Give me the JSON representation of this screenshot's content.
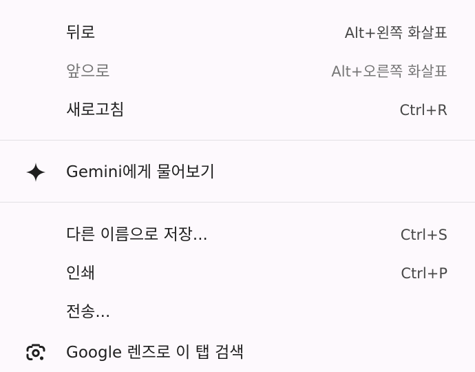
{
  "menu": {
    "items": [
      {
        "label": "뒤로",
        "shortcut": "Alt+왼쪽 화살표"
      },
      {
        "label": "앞으로",
        "shortcut": "Alt+오른쪽 화살표"
      },
      {
        "label": "새로고침",
        "shortcut": "Ctrl+R"
      },
      {
        "label": "Gemini에게 물어보기",
        "icon": "gemini-sparkle-icon"
      },
      {
        "label": "다른 이름으로 저장...",
        "shortcut": "Ctrl+S"
      },
      {
        "label": "인쇄",
        "shortcut": "Ctrl+P"
      },
      {
        "label": "전송..."
      },
      {
        "label": "Google 렌즈로 이 탭 검색",
        "icon": "google-lens-icon"
      }
    ]
  },
  "colors": {
    "background": "#fdf9fd",
    "text": "#1f1f1f",
    "disabled_text": "#767676",
    "separator": "#e2dfe3"
  }
}
